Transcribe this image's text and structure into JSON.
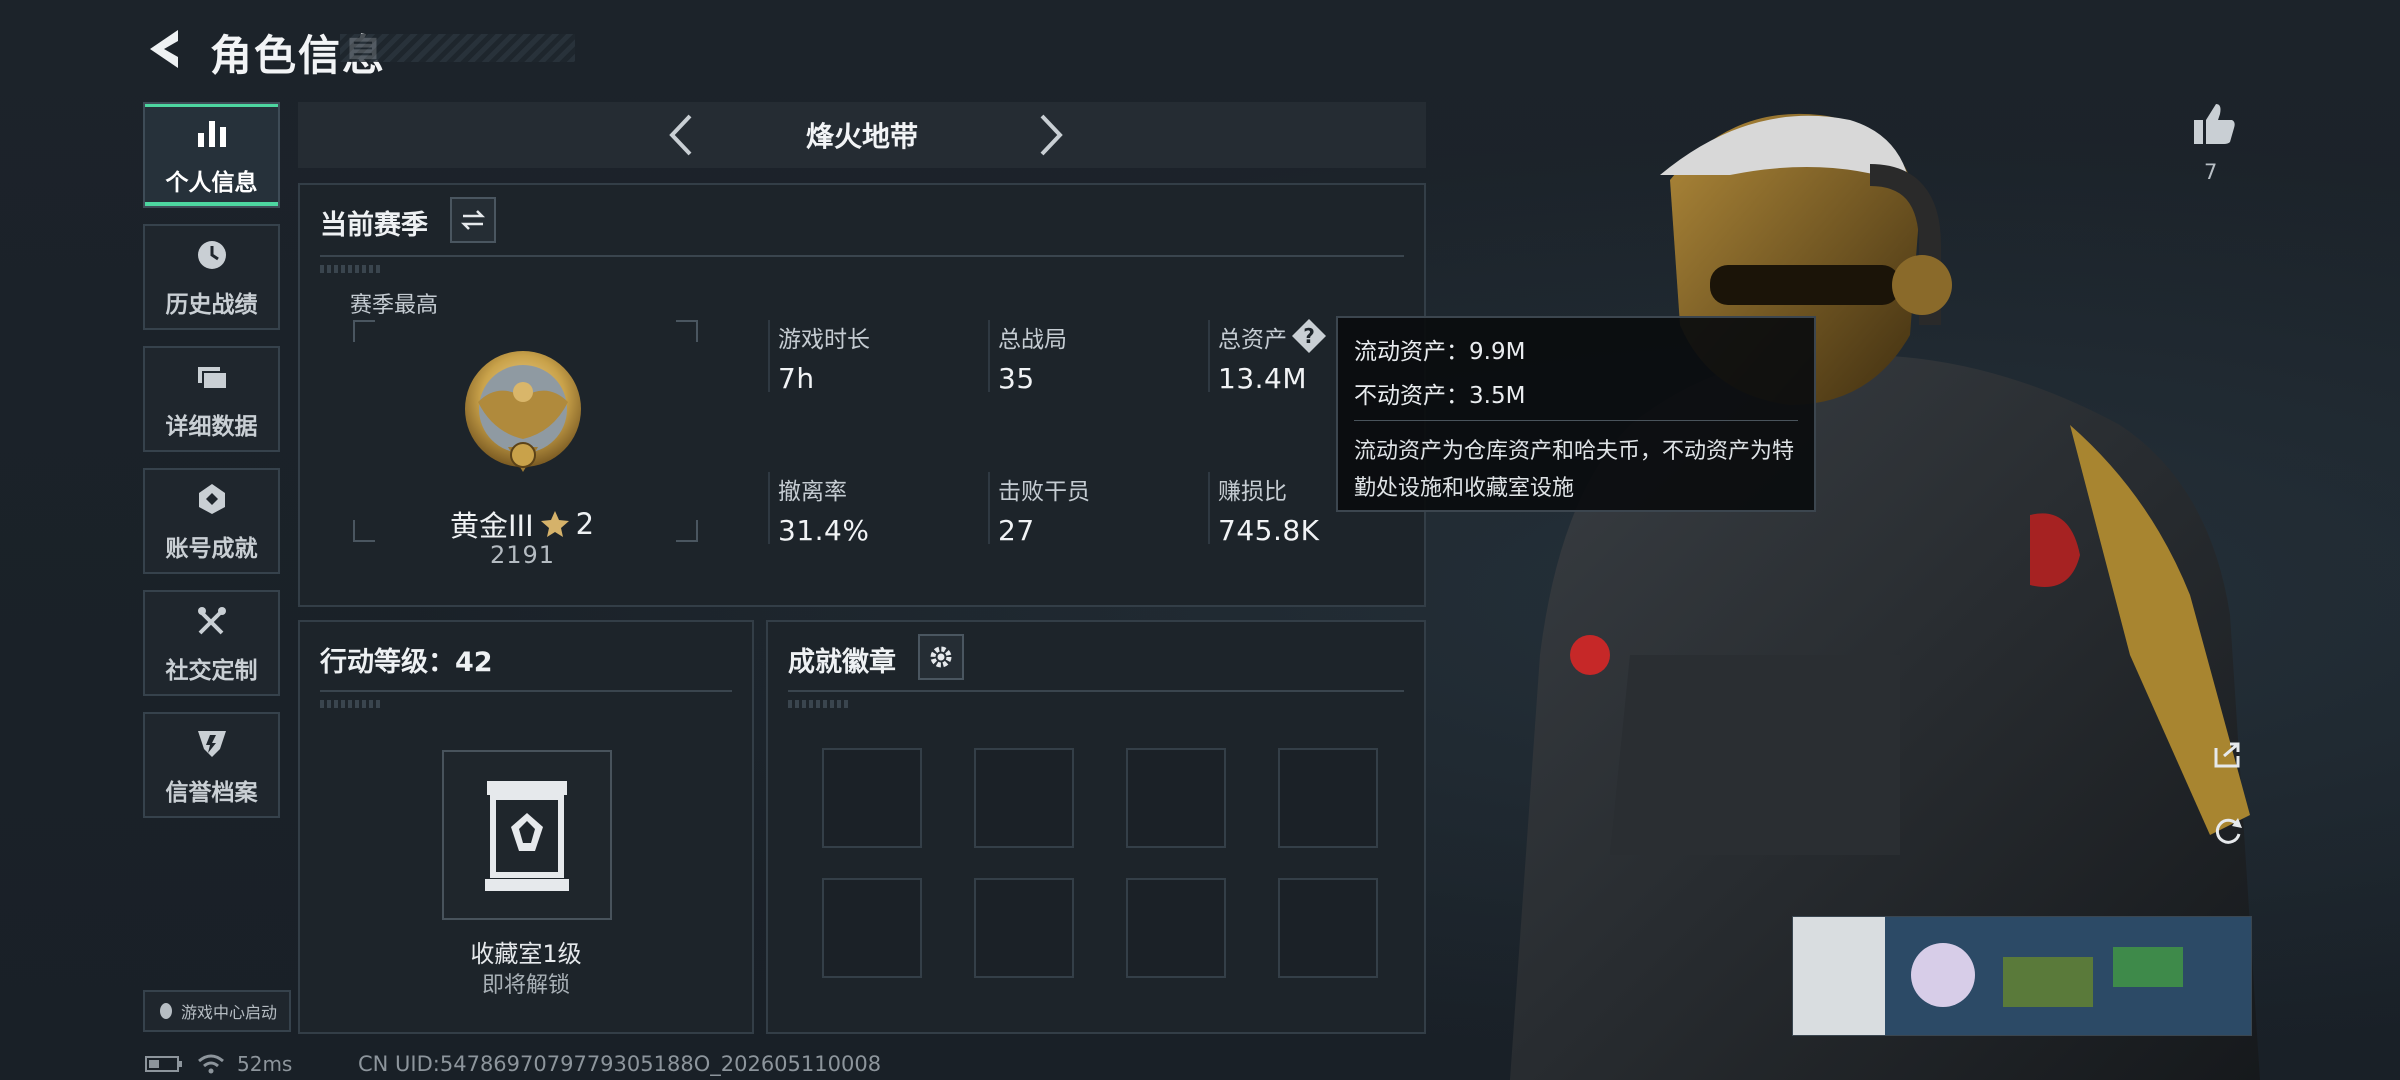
{
  "header": {
    "title": "角色信息"
  },
  "sidebar": {
    "items": [
      {
        "label": "个人信息",
        "icon": "bar-chart-icon",
        "active": true
      },
      {
        "label": "历史战绩",
        "icon": "clock-icon",
        "active": false
      },
      {
        "label": "详细数据",
        "icon": "folder-icon",
        "active": false
      },
      {
        "label": "账号成就",
        "icon": "badge-icon",
        "active": false
      },
      {
        "label": "社交定制",
        "icon": "tools-icon",
        "active": false
      },
      {
        "label": "信誉档案",
        "icon": "shield-icon",
        "active": false
      }
    ],
    "game_center": "游戏中心启动"
  },
  "mode": {
    "title": "烽火地带"
  },
  "season": {
    "header": "当前赛季",
    "best_label": "赛季最高",
    "rank_name": "黄金III",
    "rank_stars": "2",
    "rank_score": "2191",
    "stats": [
      {
        "label": "游戏时长",
        "value": "7h"
      },
      {
        "label": "总战局",
        "value": "35"
      },
      {
        "label": "总资产",
        "value": "13.4M"
      },
      {
        "label": "撤离率",
        "value": "31.4%"
      },
      {
        "label": "击败干员",
        "value": "27"
      },
      {
        "label": "赚损比",
        "value": "745.8K"
      }
    ]
  },
  "tooltip": {
    "liquid": "流动资产：9.9M",
    "fixed": "不动资产：3.5M",
    "desc": "流动资产为仓库资产和哈夫币，不动资产为特勤处设施和收藏室设施"
  },
  "action_level": {
    "header": "行动等级：42",
    "collection_title": "收藏室1级",
    "collection_sub": "即将解锁"
  },
  "badges": {
    "header": "成就徽章"
  },
  "likes": {
    "count": "7"
  },
  "status": {
    "ping": "52ms",
    "uid": "CN UID:5478697079779305188O_202605110008"
  },
  "colors": {
    "accent": "#4dd6a0",
    "gold": "#c9a24a"
  }
}
